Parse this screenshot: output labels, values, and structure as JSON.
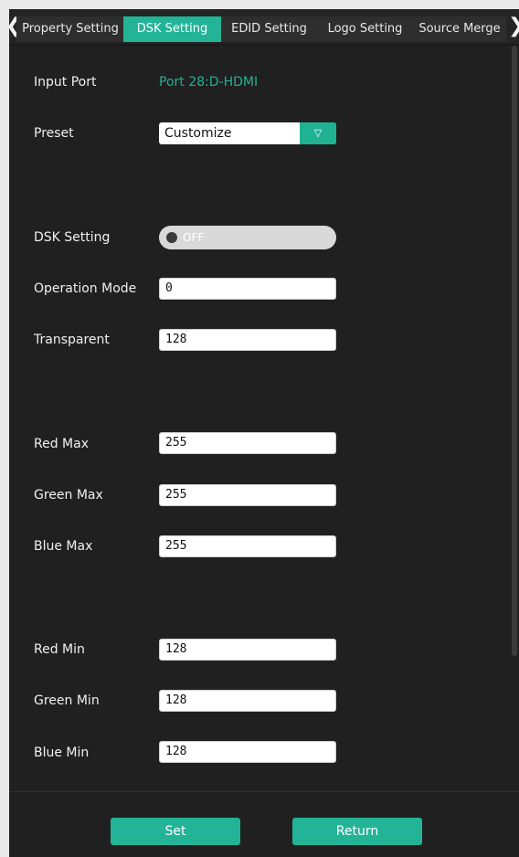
{
  "nav": {
    "left_arrow": "❮",
    "right_arrow": "❯"
  },
  "tabs": [
    {
      "label": "Property Setting"
    },
    {
      "label": "DSK Setting"
    },
    {
      "label": "EDID Setting"
    },
    {
      "label": "Logo Setting"
    },
    {
      "label": "Source Merge"
    }
  ],
  "active_tab": "DSK Setting",
  "form": {
    "input_port": {
      "label": "Input Port",
      "value": "Port 28:D-HDMI"
    },
    "preset": {
      "label": "Preset",
      "value": "Customize",
      "arrow": "▽"
    },
    "dsk_setting": {
      "label": "DSK Setting",
      "state": "OFF"
    },
    "operation_mode": {
      "label": "Operation Mode",
      "value": "0"
    },
    "transparent": {
      "label": "Transparent",
      "value": "128"
    },
    "red_max": {
      "label": "Red Max",
      "value": "255"
    },
    "green_max": {
      "label": "Green Max",
      "value": "255"
    },
    "blue_max": {
      "label": "Blue Max",
      "value": "255"
    },
    "red_min": {
      "label": "Red Min",
      "value": "128"
    },
    "green_min": {
      "label": "Green Min",
      "value": "128"
    },
    "blue_min": {
      "label": "Blue Min",
      "value": "128"
    }
  },
  "buttons": {
    "set": "Set",
    "return": "Return"
  },
  "colors": {
    "accent": "#23b497",
    "background": "#202020",
    "text": "#f0f0f0",
    "teal_text": "#1fb394"
  }
}
